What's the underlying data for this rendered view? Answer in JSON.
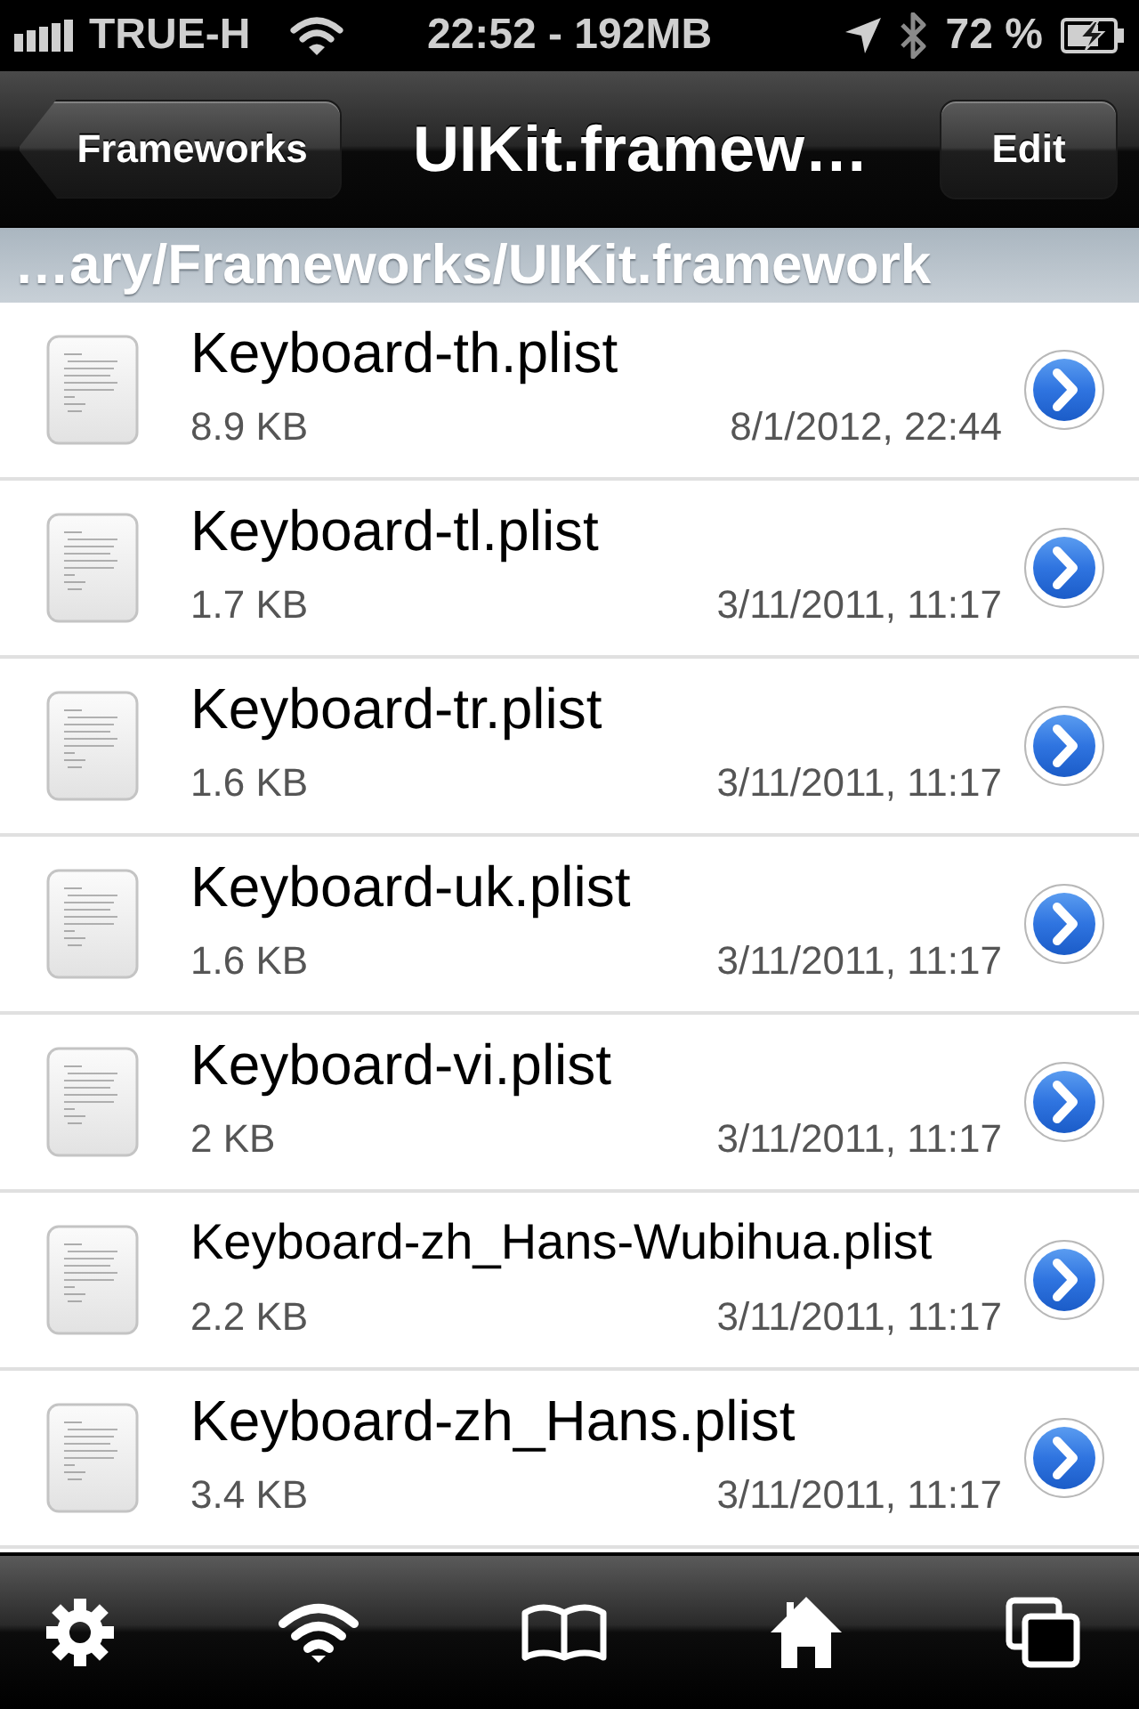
{
  "status_bar": {
    "carrier": "TRUE-H",
    "time": "22:52 - 192MB",
    "battery": "72 %"
  },
  "nav_bar": {
    "back_button": "Frameworks",
    "title": "UIKit.framew…",
    "edit_button": "Edit"
  },
  "path_bar": {
    "text": "…ary/Frameworks/UIKit.framework"
  },
  "files": [
    {
      "name": "Keyboard-th.plist",
      "size": "8.9 KB",
      "date": "8/1/2012, 22:44"
    },
    {
      "name": "Keyboard-tl.plist",
      "size": "1.7 KB",
      "date": "3/11/2011, 11:17"
    },
    {
      "name": "Keyboard-tr.plist",
      "size": "1.6 KB",
      "date": "3/11/2011, 11:17"
    },
    {
      "name": "Keyboard-uk.plist",
      "size": "1.6 KB",
      "date": "3/11/2011, 11:17"
    },
    {
      "name": "Keyboard-vi.plist",
      "size": "2 KB",
      "date": "3/11/2011, 11:17"
    },
    {
      "name": "Keyboard-zh_Hans-Wubihua.plist",
      "size": "2.2 KB",
      "date": "3/11/2011, 11:17"
    },
    {
      "name": "Keyboard-zh_Hans.plist",
      "size": "3.4 KB",
      "date": "3/11/2011, 11:17"
    }
  ]
}
